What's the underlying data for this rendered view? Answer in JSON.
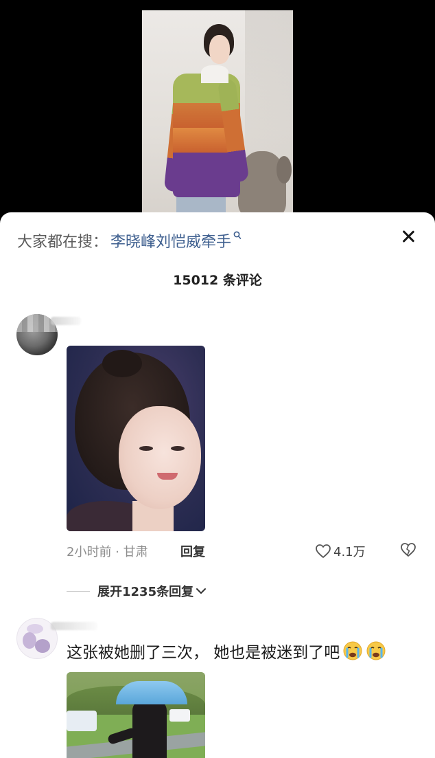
{
  "video": {},
  "sheet": {
    "hot_search_label": "大家都在搜：",
    "hot_search_query": "李晓峰刘恺威牵手",
    "close_icon": "close-icon",
    "comment_count_text": "15012 条评论"
  },
  "comments": [
    {
      "avatar_icon": "avatar",
      "image": "photo-portrait",
      "time_location": "2小时前 · 甘肃",
      "reply_label": "回复",
      "like_count": "4.1万",
      "expand_replies_text": "展开1235条回复"
    },
    {
      "avatar_icon": "avatar",
      "text": "这张被她删了三次，  她也是被迷到了吧",
      "emojis": [
        "crying-face-emoji",
        "crying-face-emoji"
      ],
      "image": "photo-umbrella"
    }
  ],
  "colors": {
    "link_blue": "#3e5f8f",
    "meta_gray": "#8d8d8d",
    "sheet_bg": "#ffffff",
    "backdrop": "#000000"
  }
}
